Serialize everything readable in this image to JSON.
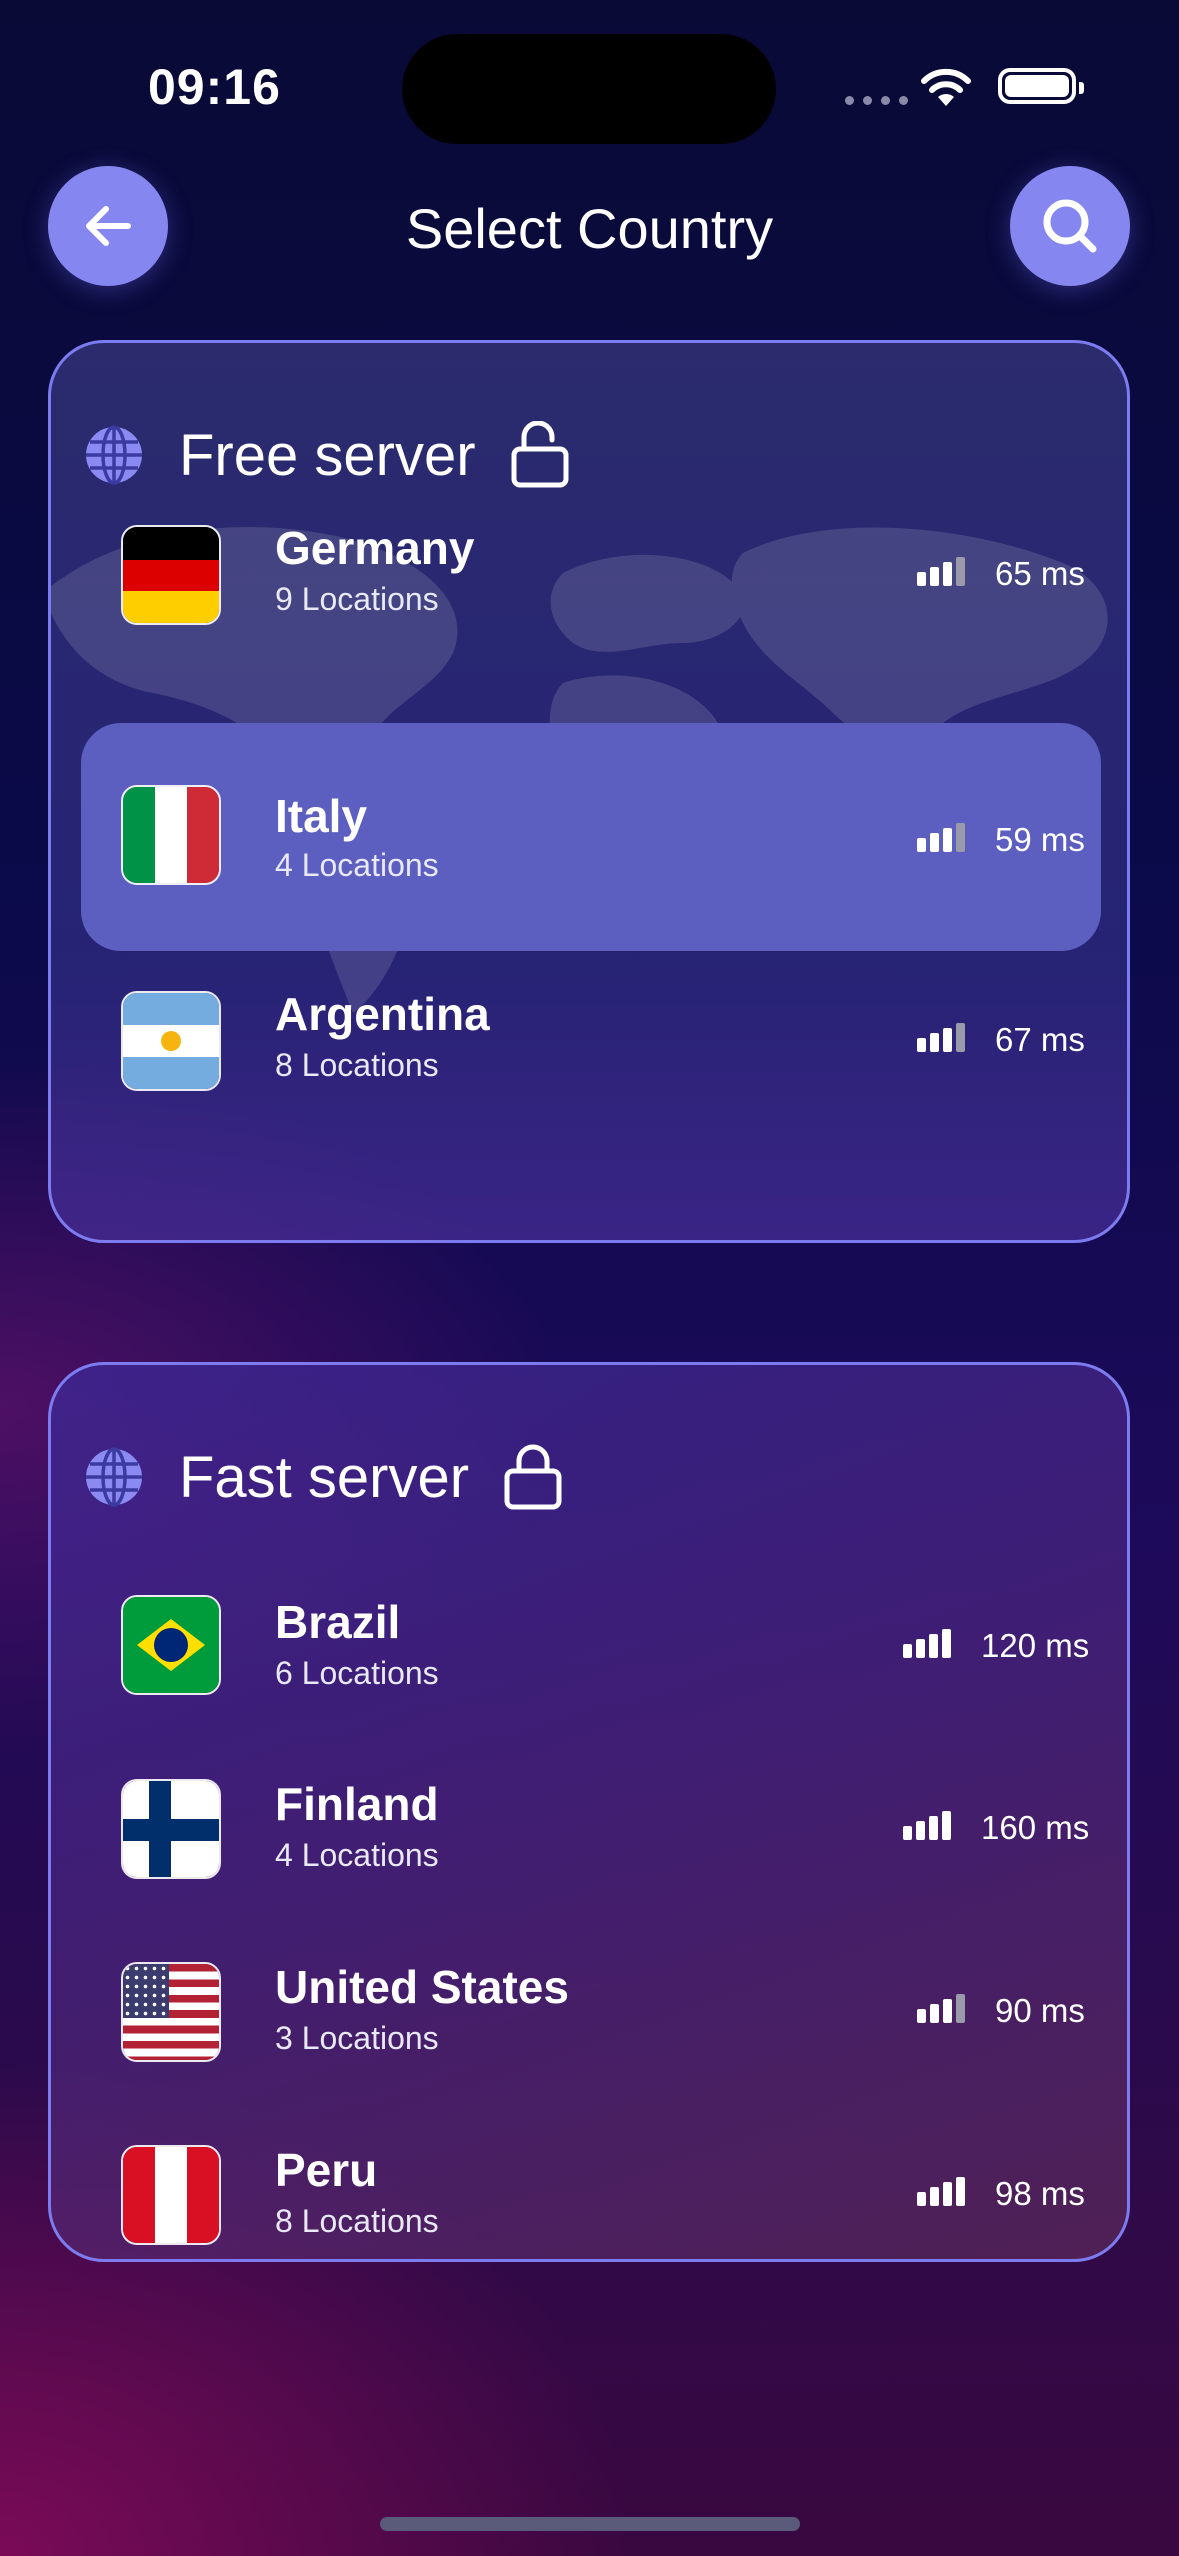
{
  "status_bar": {
    "time": "09:16"
  },
  "header": {
    "title": "Select Country",
    "back_icon": "arrow-left-icon",
    "search_icon": "search-icon"
  },
  "colors": {
    "accent": "#8686f0",
    "card_border": "#7c7cf0",
    "selected_row": "#5c5ec0"
  },
  "free_section": {
    "title": "Free server",
    "lock_icon": "unlocked-padlock-icon",
    "countries": [
      {
        "name": "Germany",
        "locations": "9 Locations",
        "ping": "65 ms",
        "signal_bars": 3,
        "selected": false
      },
      {
        "name": "Italy",
        "locations": "4 Locations",
        "ping": "59 ms",
        "signal_bars": 3,
        "selected": true
      },
      {
        "name": "Argentina",
        "locations": "8 Locations",
        "ping": "67 ms",
        "signal_bars": 3,
        "selected": false
      }
    ]
  },
  "fast_section": {
    "title": "Fast server",
    "lock_icon": "locked-padlock-icon",
    "countries": [
      {
        "name": "Brazil",
        "locations": "6 Locations",
        "ping": "120 ms",
        "signal_bars": 4
      },
      {
        "name": "Finland",
        "locations": "4 Locations",
        "ping": "160 ms",
        "signal_bars": 4
      },
      {
        "name": "United States",
        "locations": "3 Locations",
        "ping": "90 ms",
        "signal_bars": 3
      },
      {
        "name": "Peru",
        "locations": "8 Locations",
        "ping": "98 ms",
        "signal_bars": 4
      }
    ]
  }
}
